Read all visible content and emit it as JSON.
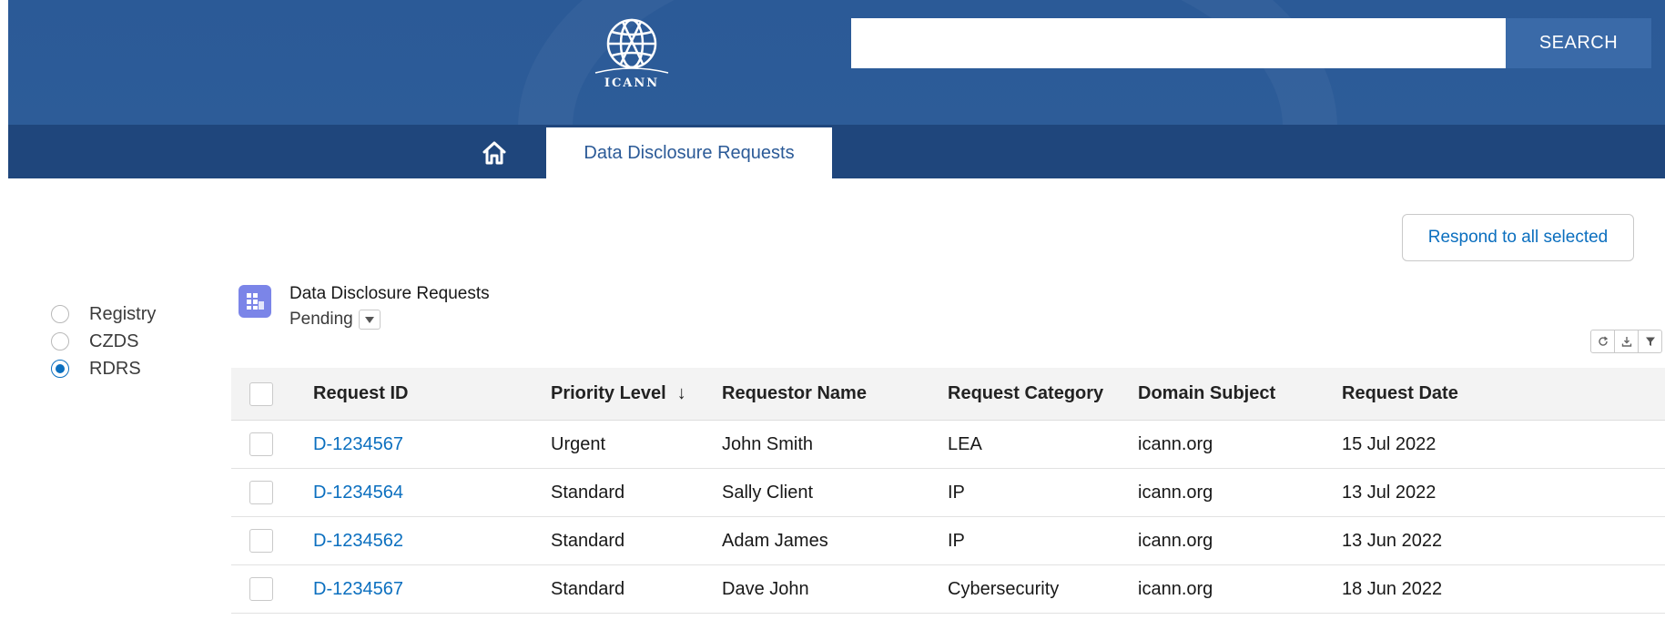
{
  "header": {
    "logo_text": "ICANN",
    "search": {
      "value": "",
      "placeholder": ""
    },
    "search_button": "SEARCH",
    "nav_tab": "Data Disclosure Requests"
  },
  "actions": {
    "respond_all": "Respond to all selected"
  },
  "sidebar": {
    "options": [
      {
        "label": "Registry",
        "checked": false
      },
      {
        "label": "CZDS",
        "checked": false
      },
      {
        "label": "RDRS",
        "checked": true
      }
    ]
  },
  "list": {
    "title": "Data Disclosure Requests",
    "view": "Pending",
    "columns": [
      "Request ID",
      "Priority Level",
      "Requestor Name",
      "Request Category",
      "Domain Subject",
      "Request Date"
    ],
    "sort_indicator": "↓",
    "rows": [
      {
        "id": "D-1234567",
        "priority": "Urgent",
        "requestor": "John Smith",
        "category": "LEA",
        "domain": "icann.org",
        "date": "15 Jul 2022"
      },
      {
        "id": "D-1234564",
        "priority": "Standard",
        "requestor": "Sally Client",
        "category": "IP",
        "domain": "icann.org",
        "date": "13 Jul 2022"
      },
      {
        "id": "D-1234562",
        "priority": "Standard",
        "requestor": "Adam James",
        "category": "IP",
        "domain": "icann.org",
        "date": "13 Jun 2022"
      },
      {
        "id": "D-1234567",
        "priority": "Standard",
        "requestor": "Dave John",
        "category": "Cybersecurity",
        "domain": "icann.org",
        "date": "18 Jun 2022"
      }
    ]
  },
  "colors": {
    "banner": "#2b5a97",
    "nav_bar": "#1f467c",
    "search_button": "#3a6aa8",
    "link": "#0b6fbf",
    "list_icon": "#7b85e8"
  },
  "icons": [
    "icann-globe-logo",
    "home-icon",
    "list-view-icon",
    "chevron-down-icon",
    "refresh-icon",
    "download-icon",
    "filter-icon"
  ]
}
